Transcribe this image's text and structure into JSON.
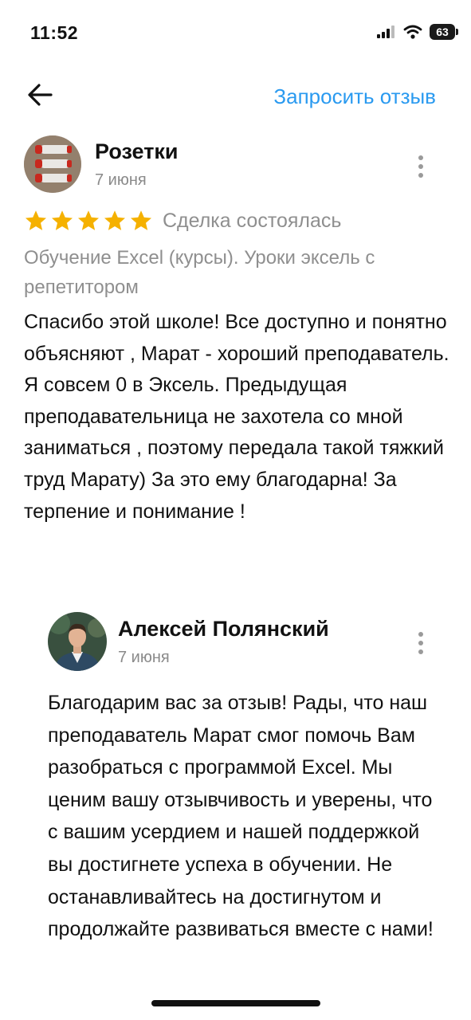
{
  "status_bar": {
    "time": "11:52",
    "battery": "63",
    "icons": [
      "signal-icon",
      "wifi-icon",
      "battery-icon"
    ]
  },
  "top_bar": {
    "back_icon": "arrow-left-icon",
    "request_review_label": "Запросить отзыв",
    "accent_color": "#2a9af0"
  },
  "review": {
    "author": "Розетки",
    "date": "7 июня",
    "rating": 5,
    "rating_max": 5,
    "star_color": "#f5b100",
    "deal_status": "Сделка состоялась",
    "product": "Обучение Excel (курсы). Уроки эксель с репетитором",
    "text": "Спасибо этой школе! Все доступно и понятно объясняют , Марат - хороший преподаватель.\nЯ совсем 0 в Эксель. Предыдущая преподавательница не захотела со мной заниматься , поэтому передала такой тяжкий труд Марату) За это ему благодарна! За терпение и понимание !"
  },
  "reply": {
    "author": "Алексей Полянский",
    "date": "7 июня",
    "text": "Благодарим вас за отзыв! Рады, что наш преподаватель Марат смог помочь Вам разобраться с программой Excel. Мы ценим вашу отзывчивость и уверены, что с вашим усердием и нашей поддержкой вы достигнете успеха в обучении. Не останавливайтесь на достигнутом и продолжайте развиваться вместе с нами!"
  }
}
